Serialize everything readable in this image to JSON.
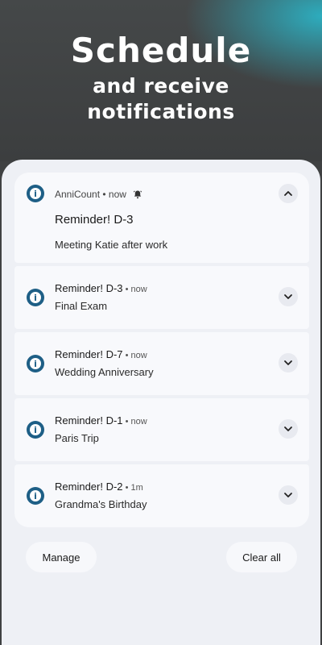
{
  "hero": {
    "line1": "Schedule",
    "line2": "and receive",
    "line3": "notifications"
  },
  "notifications": [
    {
      "app": "AnniCount",
      "time": "now",
      "title": "Reminder! D-3",
      "body": "Meeting Katie after work",
      "expanded": true,
      "icon": "info-icon"
    },
    {
      "title": "Reminder! D-3",
      "time": "now",
      "body": "Final Exam",
      "expanded": false,
      "icon": "info-icon"
    },
    {
      "title": "Reminder! D-7",
      "time": "now",
      "body": "Wedding Anniversary",
      "expanded": false,
      "icon": "info-icon"
    },
    {
      "title": "Reminder! D-1",
      "time": "now",
      "body": "Paris Trip",
      "expanded": false,
      "icon": "info-icon"
    },
    {
      "title": "Reminder! D-2",
      "time": "1m",
      "body": "Grandma's Birthday",
      "expanded": false,
      "icon": "info-icon"
    }
  ],
  "actions": {
    "manage": "Manage",
    "clear_all": "Clear all"
  },
  "colors": {
    "icon": "#1e5f86",
    "card": "#f8f9fc",
    "panel": "#eef0f5",
    "accent_glow": "#2cb2c4"
  }
}
